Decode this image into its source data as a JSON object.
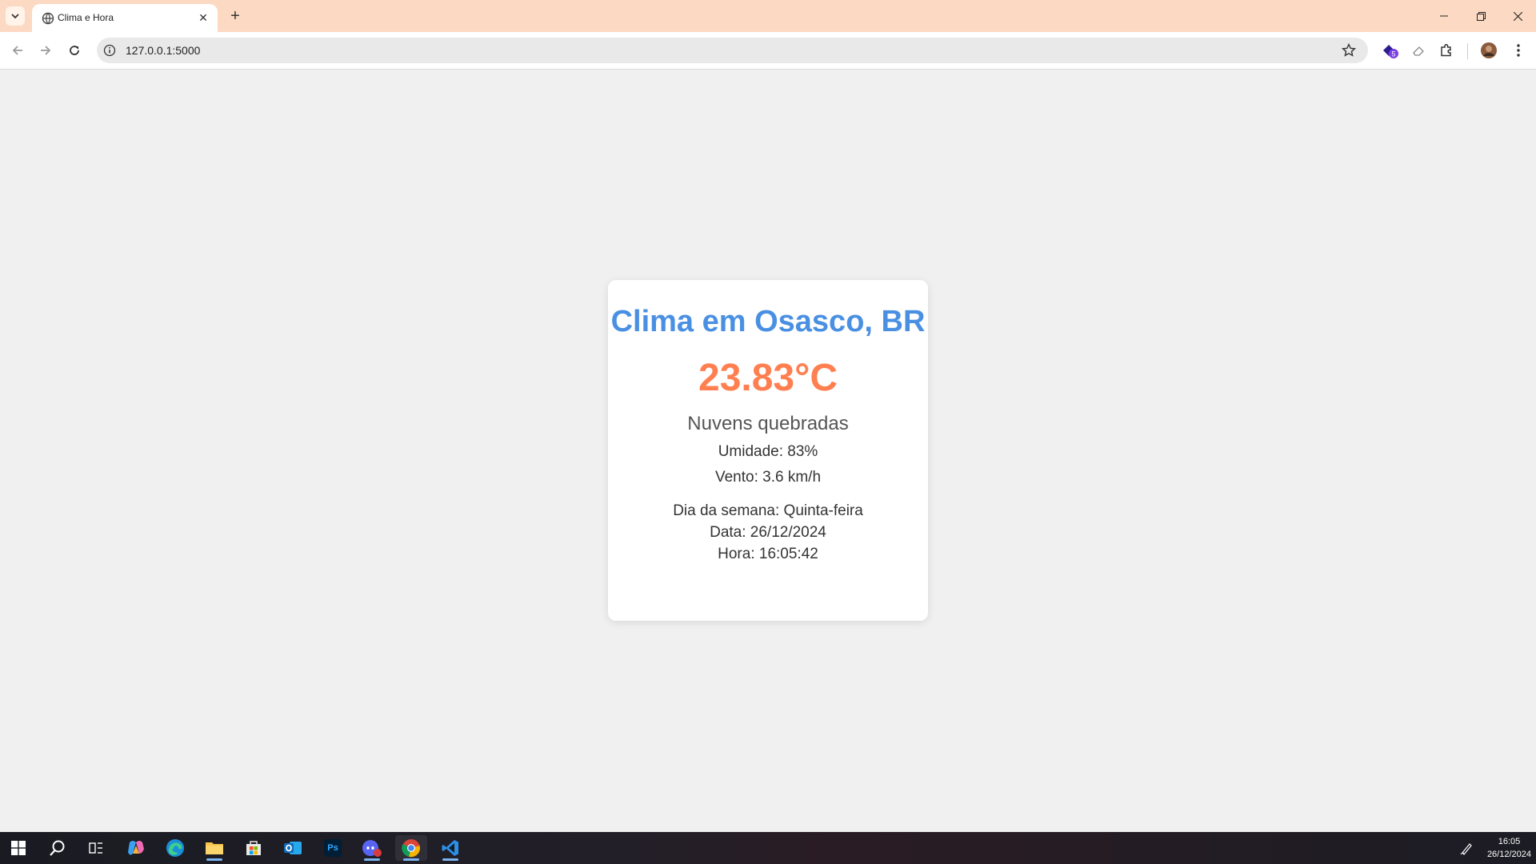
{
  "browser": {
    "tab_title": "Clima e Hora",
    "url": "127.0.0.1:5000"
  },
  "weather": {
    "title": "Clima em Osasco, BR",
    "temperature": "23.83°C",
    "description": "Nuvens quebradas",
    "humidity": "Umidade: 83%",
    "wind": "Vento: 3.6 km/h",
    "weekday": "Dia da semana: Quinta-feira",
    "date": "Data: 26/12/2024",
    "time": "Hora: 16:05:42"
  },
  "colors": {
    "title": "#4a90e2",
    "temperature": "#ff7f50",
    "tabstrip": "#fcd9c2"
  },
  "taskbar": {
    "clock_time": "16:05",
    "clock_date": "26/12/2024",
    "photoshop_label": "Ps"
  }
}
